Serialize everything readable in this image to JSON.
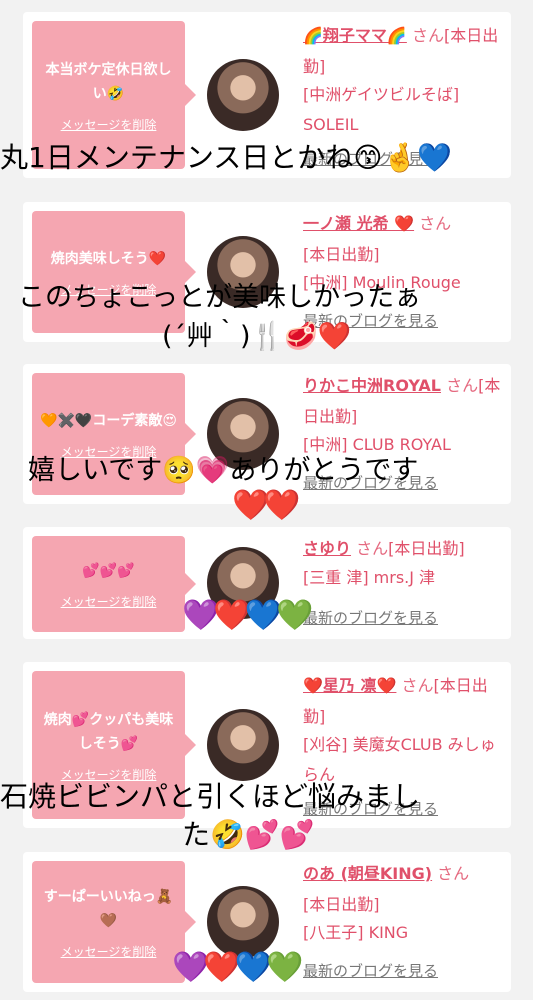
{
  "cards": [
    {
      "message": "本当ボケ定休日欲しい🤣",
      "delete": "メッセージを削除",
      "name": "🌈翔子ママ🌈",
      "san": "さん",
      "status": "[本日出勤]",
      "shop": "[中洲ゲイツビルそば] SOLEIL",
      "blog": "最新のブログを見る"
    },
    {
      "message": "焼肉美味しそう❤️",
      "delete": "メッセージを削除",
      "name": "一ノ瀬 光希 ❤️",
      "san": "さん",
      "status": "[本日出勤]",
      "shop": "[中洲] Moulin Rouge",
      "blog": "最新のブログを見る"
    },
    {
      "message": "🧡✖️🖤コーデ素敵😍",
      "delete": "メッセージを削除",
      "name": "りかこ中洲ROYAL",
      "san": "さん",
      "status": "[本日出勤]",
      "shop": "[中洲] CLUB ROYAL",
      "blog": "最新のブログを見る"
    },
    {
      "message": "💕💕💕",
      "delete": "メッセージを削除",
      "name": "さゆり",
      "san": "さん",
      "status": "[本日出勤]",
      "shop": "[三重 津] mrs.J 津",
      "blog": "最新のブログを見る"
    },
    {
      "message": "焼肉💕クッパも美味しそう💕",
      "delete": "メッセージを削除",
      "name": "❤️星乃 凛❤️",
      "san": "さん",
      "status": "[本日出勤]",
      "shop": "[刈谷] 美魔女CLUB みしゅらん",
      "blog": "最新のブログを見る"
    },
    {
      "message": "すーぱーいいねっ🧸🤎",
      "delete": "メッセージを削除",
      "name": "のあ (朝昼KING)",
      "san": "さん",
      "status": "[本日出勤]",
      "shop": "[八王子] KING",
      "blog": "最新のブログを見る"
    }
  ],
  "overlays": {
    "line1": "丸1日メンテナンス日とかね😙🤞💙",
    "line2a": "このちょこっとが美味しかったぁ",
    "line2b": "(´艸｀)🍴🥩❤️",
    "line3a": "嬉しいです🥺💗ありがとうです",
    "line3b": "❤️❤️",
    "line4": "💜❤️💙💚",
    "line5a": "石焼ビビンパと引くほど悩みまし",
    "line5b": "た🤣💕💕",
    "line6": "💜❤️💙💚"
  }
}
